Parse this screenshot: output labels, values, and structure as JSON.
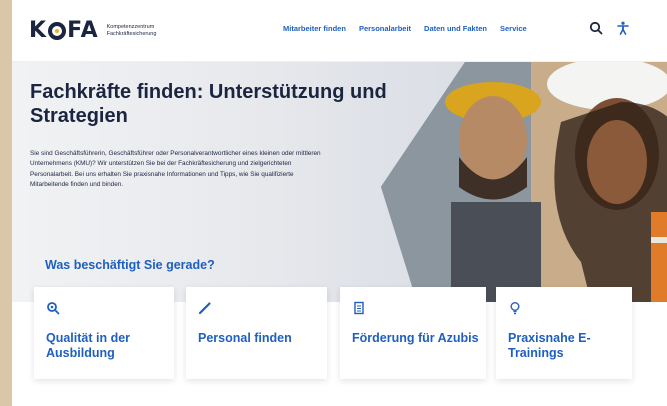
{
  "header": {
    "logo_text_1": "K",
    "logo_text_2": "FA",
    "logo_subtitle": "Kompetenzzentrum Fachkräftesicherung",
    "nav": [
      {
        "label": "Mitarbeiter finden"
      },
      {
        "label": "Personalarbeit"
      },
      {
        "label": "Daten und Fakten"
      },
      {
        "label": "Service"
      }
    ],
    "search_icon": "search-icon",
    "accessibility_icon": "accessibility-icon"
  },
  "hero": {
    "title": "Fachkräfte finden: Unterstützung und Strategien",
    "text": "Sie sind Geschäftsführerin, Geschäftsführer oder Personalverantwortlicher eines kleinen oder mittleren Unternehmens (KMU)? Wir unterstützen Sie bei der Fachkräftesicherung und zielgerichteten Personalarbeit. Bei uns erhalten Sie praxisnahe Informationen und Tipps, wie Sie qualifizierte Mitarbeitende finden und binden.",
    "question": "Was beschäftigt Sie gerade?"
  },
  "cards": [
    {
      "label": "Qualität in der Ausbildung",
      "icon": "search-magnifier-icon"
    },
    {
      "label": "Personal finden",
      "icon": "pen-icon"
    },
    {
      "label": "Förderung für Azubis",
      "icon": "document-icon"
    },
    {
      "label": "Praxisnahe E-Trainings",
      "icon": "lightbulb-icon"
    }
  ],
  "colors": {
    "accent": "#1f5fbf",
    "navy": "#1b2540",
    "logo_dot": "#f2b21b"
  }
}
